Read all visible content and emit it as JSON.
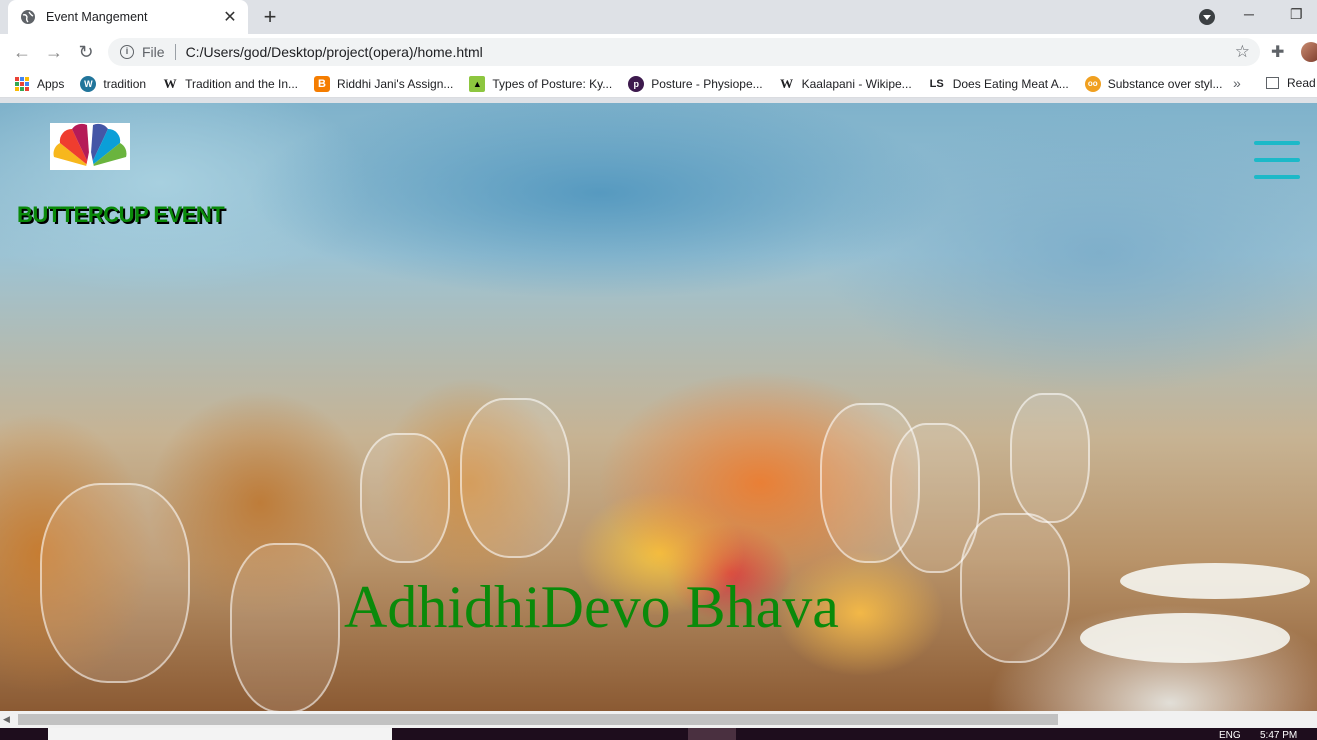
{
  "browser": {
    "tab_title": "Event Mangement",
    "url_scheme": "File",
    "url": "C:/Users/god/Desktop/project(opera)/home.html"
  },
  "bookmarks": [
    {
      "label": "Apps",
      "icon": "apps-grid-icon"
    },
    {
      "label": "tradition",
      "icon": "wordpress-icon",
      "color": "#21759b"
    },
    {
      "label": "Tradition and the In...",
      "icon": "wikipedia-icon"
    },
    {
      "label": "Riddhi Jani's Assign...",
      "icon": "blogger-icon",
      "color": "#f57d00"
    },
    {
      "label": "Types of Posture: Ky...",
      "icon": "posture-icon",
      "color": "#8dc63f"
    },
    {
      "label": "Posture - Physiope...",
      "icon": "physiopedia-icon",
      "color": "#3d1a4d"
    },
    {
      "label": "Kaalapani - Wikipe...",
      "icon": "wikipedia-icon"
    },
    {
      "label": "Does Eating Meat A...",
      "icon": "ls-icon"
    },
    {
      "label": "Substance over styl...",
      "icon": "substance-icon",
      "color": "#f0a020"
    }
  ],
  "bookmarks_more": "»",
  "reading_list": "Read",
  "page": {
    "brand": "BUTTERCUP EVENT",
    "tagline": "AdhidhiDevo Bhava",
    "brand_color": "#0a8a0a",
    "menu_color": "#1cb9c8"
  },
  "taskbar": {
    "lang": "ENG",
    "time": "5:47 PM"
  }
}
